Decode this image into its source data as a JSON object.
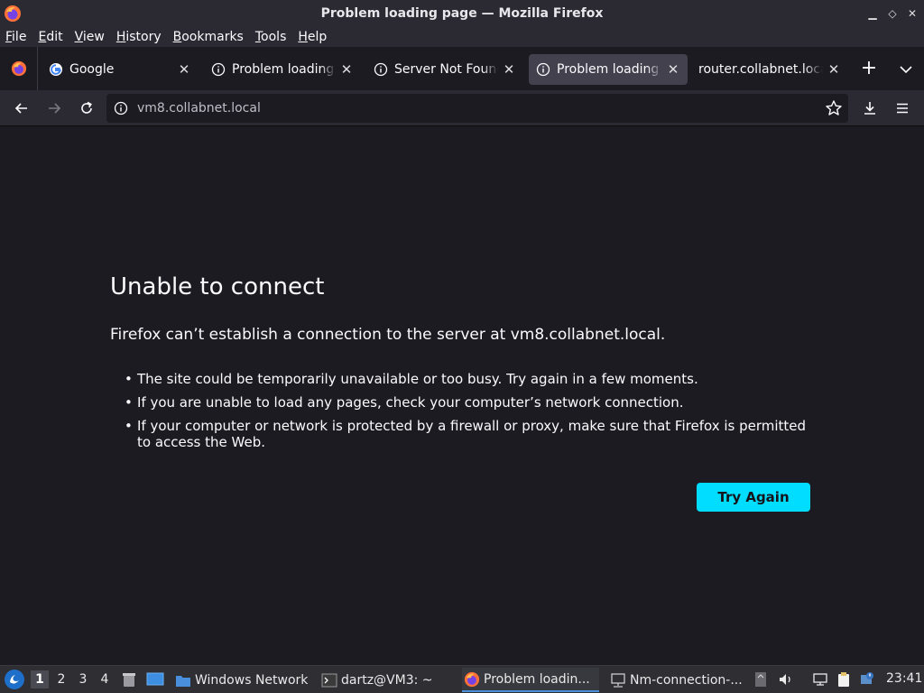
{
  "window": {
    "title": "Problem loading page — Mozilla Firefox"
  },
  "menu": [
    "File",
    "Edit",
    "View",
    "History",
    "Bookmarks",
    "Tools",
    "Help"
  ],
  "tabs": [
    {
      "label": "Google",
      "icon": "google-icon",
      "active": false
    },
    {
      "label": "Problem loading page",
      "icon": "info-icon",
      "active": false
    },
    {
      "label": "Server Not Found",
      "icon": "info-icon",
      "active": false
    },
    {
      "label": "Problem loading page",
      "icon": "info-icon",
      "active": true
    },
    {
      "label": "router.collabnet.local/",
      "icon": "",
      "active": false
    }
  ],
  "newtab_label": "+",
  "urlbar": {
    "value": "vm8.collabnet.local"
  },
  "error": {
    "title": "Unable to connect",
    "description": "Firefox can’t establish a connection to the server at vm8.collabnet.local.",
    "items": [
      "The site could be temporarily unavailable or too busy. Try again in a few moments.",
      "If you are unable to load any pages, check your computer’s network connection.",
      "If your computer or network is protected by a firewall or proxy, make sure that Firefox is permitted to access the Web."
    ],
    "button_label": "Try Again"
  },
  "taskbar": {
    "workspaces": [
      "1",
      "2",
      "3",
      "4"
    ],
    "active_workspace": "1",
    "tasks": [
      {
        "label": "Windows Network",
        "icon": "folder-icon"
      },
      {
        "label": "dartz@VM3: ~",
        "icon": "terminal-icon"
      },
      {
        "label": "Problem loadin...",
        "icon": "firefox-icon",
        "active": true
      },
      {
        "label": "Nm-connection-...",
        "icon": "network-icon"
      }
    ],
    "clock": "23:41"
  },
  "colors": {
    "accent": "#00ddff",
    "page_bg": "#1c1b22",
    "toolbar_bg": "#2b2a33",
    "active_tab_bg": "#42414d"
  }
}
